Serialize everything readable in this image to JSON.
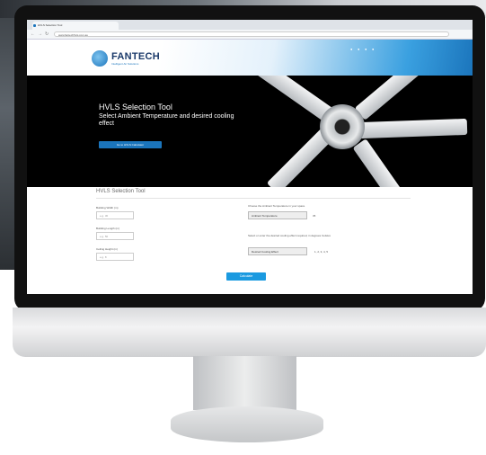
{
  "browser": {
    "tab_title": "HVLS Selection Tool",
    "url": "www.fantechhvls.com.au",
    "nav_back": "←",
    "nav_forward": "→",
    "nav_reload": "↻"
  },
  "site": {
    "logo_text": "FANTECH",
    "logo_tagline": "Intelligent Air Solutions"
  },
  "hero": {
    "title": "HVLS Selection Tool",
    "subtitle": "Select Ambient Temperature and desired cooling effect",
    "button_label": "Go to HVLS Calculator"
  },
  "tool": {
    "section_title": "HVLS Selection Tool",
    "fields": [
      {
        "label": "Building Width (m)",
        "placeholder": "e.g. 30"
      },
      {
        "label": "Building Length (m)",
        "placeholder": "e.g. 50"
      },
      {
        "label": "Ceiling Height (m)",
        "placeholder": "e.g. 8"
      }
    ],
    "temp_note": "Choose the Ambient Temperature in your space",
    "temp_select": "Ambient Temperature",
    "temp_value": "35",
    "cooling_note": "Select or enter the desired cooling effect required, in degrees Celsius",
    "cooling_select": "Desired Cooling Effect",
    "cooling_value": "1, 2, 3, 4, 5",
    "calculate_label": "Calculate"
  },
  "colors": {
    "brand_blue": "#1b75bc",
    "button_blue": "#1b9ae0"
  }
}
